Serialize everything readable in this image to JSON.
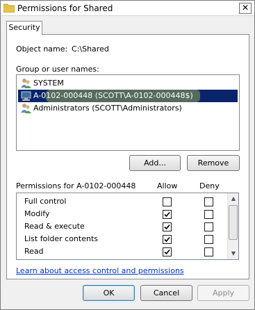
{
  "window": {
    "title": "Permissions for Shared",
    "close_glyph": "✕"
  },
  "tabs": [
    {
      "label": "Security",
      "selected": true
    }
  ],
  "object": {
    "label": "Object name:",
    "value": "C:\\Shared"
  },
  "groups": {
    "label": "Group or user names:",
    "items": [
      {
        "name": "SYSTEM",
        "icon": "users-icon",
        "selected": false
      },
      {
        "name": "A-0102-000448 (SCOTT\\A-0102-000448$)",
        "icon": "computer-icon",
        "selected": true
      },
      {
        "name": "Administrators (SCOTT\\Administrators)",
        "icon": "users-icon",
        "selected": false
      }
    ],
    "add_label": "Add...",
    "remove_label": "Remove"
  },
  "permissions": {
    "label": "Permissions for A-0102-000448",
    "allow_header": "Allow",
    "deny_header": "Deny",
    "rows": [
      {
        "name": "Full control",
        "allow": false,
        "deny": false
      },
      {
        "name": "Modify",
        "allow": true,
        "deny": false
      },
      {
        "name": "Read & execute",
        "allow": true,
        "deny": false
      },
      {
        "name": "List folder contents",
        "allow": true,
        "deny": false
      },
      {
        "name": "Read",
        "allow": true,
        "deny": false
      }
    ]
  },
  "link": "Learn about access control and permissions",
  "buttons": {
    "ok": "OK",
    "cancel": "Cancel",
    "apply": "Apply"
  },
  "colors": {
    "selection": "#0a246a",
    "highlight": "#e6f04a",
    "link": "#0033cc"
  }
}
